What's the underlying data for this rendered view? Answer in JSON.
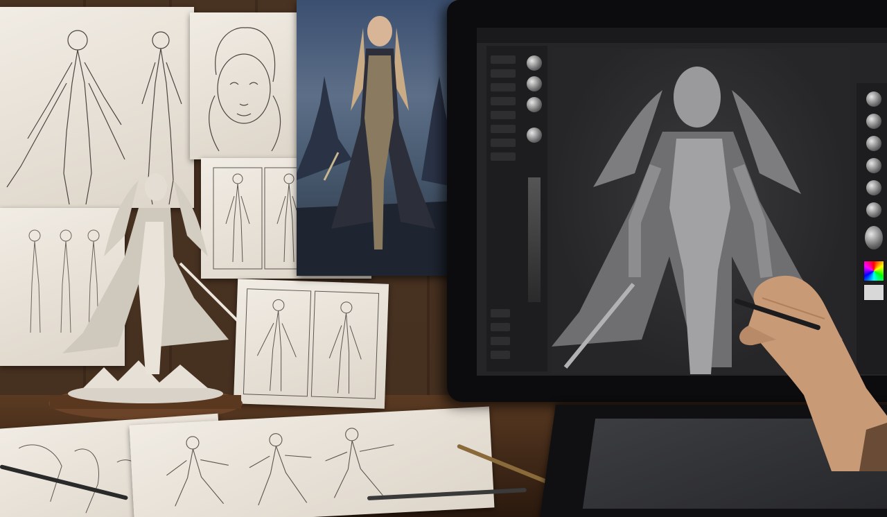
{
  "scene": {
    "description_kind": "photo",
    "palette": {
      "wall": "#4a3322",
      "desk": "#5a3a22",
      "paper": "#ede7de",
      "poster_sky": "#3b4f70",
      "screen_bg": "#252527",
      "sculpt_gray": "#8c8c8e",
      "skin": "#c99a76"
    }
  },
  "icons": {
    "pencil": "pencil-icon",
    "stylus": "stylus-icon",
    "brush": "brush-icon",
    "material": "material-sphere-icon",
    "color_picker": "color-picker-icon"
  }
}
